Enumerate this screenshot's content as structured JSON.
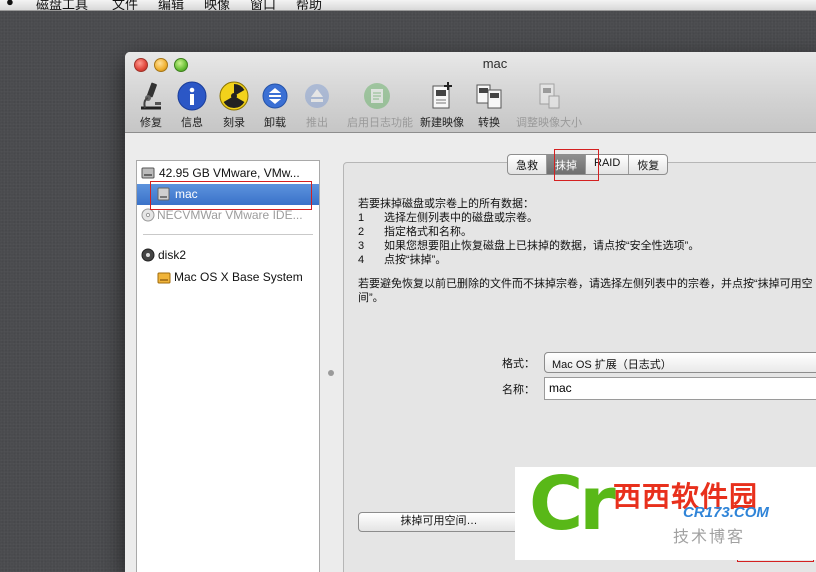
{
  "menubar": {
    "apple": "",
    "items": [
      "磁盘工具",
      "文件",
      "编辑",
      "映像",
      "窗口",
      "帮助"
    ]
  },
  "window": {
    "title": "mac"
  },
  "toolbar": {
    "items": [
      {
        "label": "修复",
        "icon": "microscope-icon",
        "enabled": true
      },
      {
        "label": "信息",
        "icon": "info-icon",
        "enabled": true
      },
      {
        "label": "刻录",
        "icon": "burn-icon",
        "enabled": true
      },
      {
        "label": "卸载",
        "icon": "unmount-icon",
        "enabled": true
      },
      {
        "label": "推出",
        "icon": "eject-icon",
        "enabled": false
      },
      {
        "label": "启用日志功能",
        "icon": "journal-icon",
        "enabled": false
      },
      {
        "label": "新建映像",
        "icon": "new-image-icon",
        "enabled": true
      },
      {
        "label": "转换",
        "icon": "convert-icon",
        "enabled": true
      },
      {
        "label": "调整映像大小",
        "icon": "resize-image-icon",
        "enabled": false
      }
    ]
  },
  "sidebar": {
    "items": [
      {
        "label": "42.95 GB VMware, VMw...",
        "icon": "hard-disk-icon"
      },
      {
        "label": "mac",
        "icon": "volume-icon",
        "selected": true
      },
      {
        "label": "NECVMWar VMware IDE...",
        "icon": "optical-drive-icon",
        "dim": true
      },
      {
        "label": "disk2",
        "icon": "disk-image-icon"
      },
      {
        "label": "Mac OS X Base System",
        "icon": "mounted-volume-icon"
      }
    ]
  },
  "tabs": [
    {
      "label": "急救"
    },
    {
      "label": "抹掉",
      "active": true
    },
    {
      "label": "RAID"
    },
    {
      "label": "恢复"
    }
  ],
  "erase": {
    "intro": "若要抹掉磁盘或宗卷上的所有数据：",
    "steps": [
      {
        "num": "1",
        "text": "选择左侧列表中的磁盘或宗卷。"
      },
      {
        "num": "2",
        "text": "指定格式和名称。"
      },
      {
        "num": "3",
        "text": "如果您想要阻止恢复磁盘上已抹掉的数据，请点按“安全性选项”。"
      },
      {
        "num": "4",
        "text": "点按“抹掉”。"
      }
    ],
    "note": "若要避免恢复以前已删除的文件而不抹掉宗卷，请选择左侧列表中的宗卷，并点按“抹掉可用空间”。",
    "format_label": "格式：",
    "format_value": "Mac OS 扩展（日志式）",
    "name_label": "名称：",
    "name_value": "mac",
    "erase_free_space_button": "抹掉可用空间…"
  },
  "watermark": {
    "logo": "Cr",
    "site": "西西软件园",
    "url": "CR173.COM",
    "blog": "技术博客"
  },
  "colors": {
    "selection": "#3a72c9",
    "annotation": "#d42020",
    "watermark_green": "#59b818",
    "watermark_red": "#e8301c"
  }
}
